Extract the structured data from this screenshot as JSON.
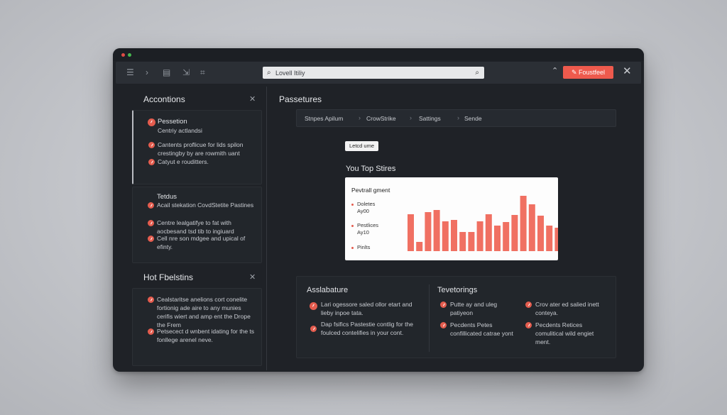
{
  "toolbar": {
    "search_value": "Lovell Itiliy",
    "primary_button": "Foustfeel"
  },
  "sidebar": {
    "section1_title": "Accontions",
    "card1": {
      "title": "Pessetion",
      "subtitle": "Centriy actlandsi",
      "items": [
        "Cantents proflicue for lids spilon crestingby by are rowmith uant",
        "Catyut e rouditters."
      ]
    },
    "card2": {
      "title": "Tetdus",
      "items": [
        "Acail stekation CovdStetite Pastines",
        "Centre lealgatifye to fat with aocbesand tsd tib to ingiuard",
        "Cell nre son mdgee and upical of efinty."
      ]
    },
    "section2_title": "Hot Fbelstins",
    "card3": {
      "items": [
        "Cealstaritse anelions cort conelite fortionig ade aire to any munies cerifis wiert and amp ent the Drope the Frem",
        "Petsecect d wnbent idating for the ts fonllege arenel neve."
      ]
    }
  },
  "main": {
    "title": "Passetures",
    "breadcrumbs": [
      "Stnpes Apilum",
      "CrowStrike",
      "Sattings",
      "Sende"
    ],
    "small_button": "Letcd ume",
    "chart_heading": "You Top Stires",
    "chart_card_title": "Pevtrall gment",
    "legend": [
      {
        "label": "Doletes",
        "sub": "Ay00"
      },
      {
        "label": "Pestlices",
        "sub": "Ay10"
      },
      {
        "label": "Pinlts",
        "sub": ""
      }
    ],
    "bottom": {
      "left_title": "Asslabature",
      "left_items": [
        "Lari ogessore saled ollor etart and lieby inpoe tata.",
        "Dap fsifics Pastestie contlig for the foulced contelifies in your cont."
      ],
      "right_title": "Tevetorings",
      "right_col1": [
        "Putte ay and uleg patiyeon",
        "Pecdents Petes confillicated catrae yont"
      ],
      "right_col2": [
        "Crov ater ed salied inett conteya.",
        "Pecdents Retices comulitical wild engiet ment."
      ]
    }
  },
  "colors": {
    "accent": "#ee5a4d",
    "bar": "#f07062",
    "window_bg": "#1f2227"
  },
  "chart_data": {
    "type": "bar",
    "title": "Pevtrall gment",
    "values": [
      52,
      13,
      55,
      58,
      42,
      44,
      27,
      27,
      42,
      52,
      36,
      41,
      51,
      78,
      66,
      50,
      36,
      33,
      31
    ]
  }
}
